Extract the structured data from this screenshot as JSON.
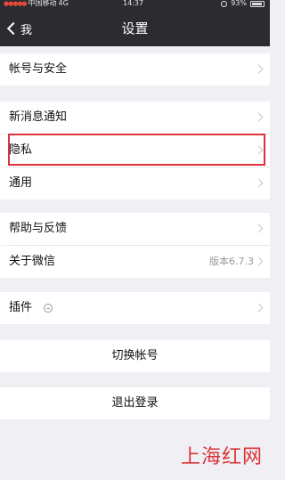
{
  "status": {
    "carrier": "中国移动",
    "network": "4G",
    "time": "14:37",
    "battery": "93%"
  },
  "nav": {
    "back_label": "我",
    "title": "设置"
  },
  "items": {
    "account_security": "帐号与安全",
    "new_message": "新消息通知",
    "privacy": "隐私",
    "general": "通用",
    "help_feedback": "帮助与反馈",
    "about": "关于微信",
    "about_version": "版本6.7.3",
    "plugins": "插件",
    "switch_account": "切换帐号",
    "logout": "退出登录"
  },
  "watermark": "上海红网",
  "colors": {
    "header_bg": "#2b2b30",
    "highlight": "#e0323b",
    "page_bg": "#efeff4"
  },
  "icons": {
    "back": "chevron-left-icon",
    "row_arrow": "chevron-right-icon",
    "plugin": "plugin-status-icon"
  }
}
